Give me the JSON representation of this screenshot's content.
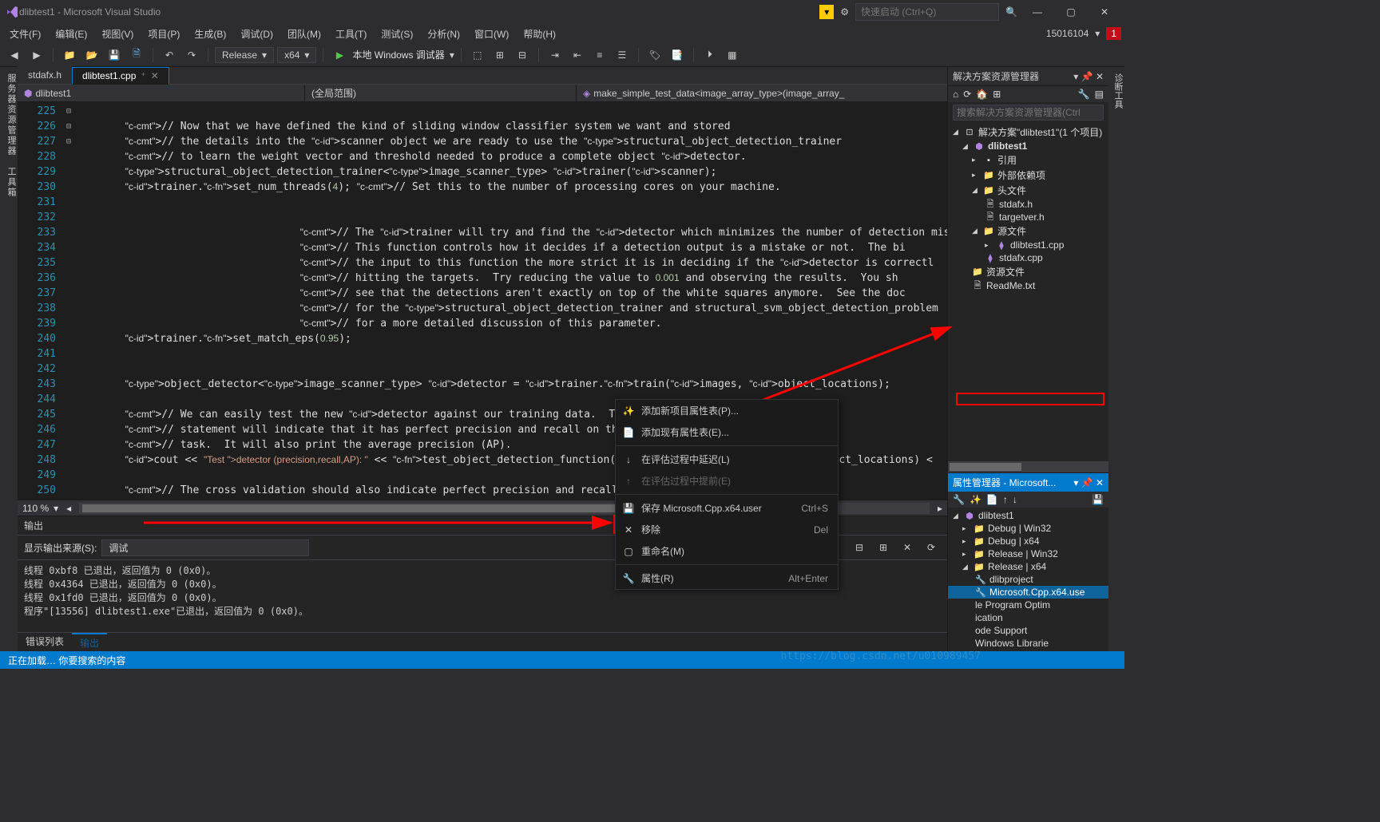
{
  "titlebar": {
    "title": "dlibtest1 - Microsoft Visual Studio",
    "quickstart": "快速启动 (Ctrl+Q)"
  },
  "menubar": {
    "items": [
      "文件(F)",
      "编辑(E)",
      "视图(V)",
      "项目(P)",
      "生成(B)",
      "调试(D)",
      "团队(M)",
      "工具(T)",
      "测试(S)",
      "分析(N)",
      "窗口(W)",
      "帮助(H)"
    ],
    "userid": "15016104",
    "notif": "1"
  },
  "toolbar": {
    "config": "Release",
    "platform": "x64",
    "debugger": "本地 Windows 调试器"
  },
  "tabs": {
    "inactive": "stdafx.h",
    "active": "dlibtest1.cpp"
  },
  "navbar": {
    "proj": "dlibtest1",
    "scope": "(全局范围)",
    "func": "make_simple_test_data<image_array_type>(image_array_"
  },
  "lines": {
    "start": 225,
    "end": 250
  },
  "code": [
    "",
    "        // Now that we have defined the kind of sliding window classifier system we want and stored",
    "        // the details into the scanner object we are ready to use the structural_object_detection_trainer",
    "        // to learn the weight vector and threshold needed to produce a complete object detector.",
    "        structural_object_detection_trainer<image_scanner_type> trainer(scanner);",
    "        trainer.set_num_threads(4); // Set this to the number of processing cores on your machine.",
    "",
    "",
    "                                    // The trainer will try and find the detector which minimizes the number of detection mista",
    "                                    // This function controls how it decides if a detection output is a mistake or not.  The bi",
    "                                    // the input to this function the more strict it is in deciding if the detector is correctl",
    "                                    // hitting the targets.  Try reducing the value to 0.001 and observing the results.  You sh",
    "                                    // see that the detections aren't exactly on top of the white squares anymore.  See the doc",
    "                                    // for the structural_object_detection_trainer and structural_svm_object_detection_problem ",
    "                                    // for a more detailed discussion of this parameter.",
    "        trainer.set_match_eps(0.95);",
    "",
    "",
    "        object_detector<image_scanner_type> detector = trainer.train(images, object_locations);",
    "",
    "        // We can easily test the new detector against our training data.  This print ",
    "        // statement will indicate that it has perfect precision and recall on this simple",
    "        // task.  It will also print the average precision (AP).",
    "        cout << \"Test detector (precision,recall,AP): \" << test_object_detection_function(detector, images, object_locations) <",
    "",
    "        // The cross validation should also indicate perfect precision and recall."
  ],
  "zoom": "110 %",
  "output": {
    "title": "输出",
    "src_label": "显示输出来源(S):",
    "src_value": "调试",
    "lines": [
      "线程 0xbf8 已退出，返回值为 0 (0x0)。",
      "线程 0x4364 已退出，返回值为 0 (0x0)。",
      "线程 0x1fd0 已退出，返回值为 0 (0x0)。",
      "程序\"[13556] dlibtest1.exe\"已退出，返回值为 0 (0x0)。"
    ],
    "footer": [
      "错误列表",
      "输出"
    ]
  },
  "solution": {
    "title": "解决方案资源管理器",
    "search_ph": "搜索解决方案资源管理器(Ctrl",
    "root": "解决方案\"dlibtest1\"(1 个项目)",
    "proj": "dlibtest1",
    "refs": "引用",
    "ext": "外部依赖项",
    "headers": "头文件",
    "h1": "stdafx.h",
    "h2": "targetver.h",
    "src": "源文件",
    "s1": "dlibtest1.cpp",
    "s2": "stdafx.cpp",
    "res": "资源文件",
    "readme": "ReadMe.txt"
  },
  "props": {
    "title": "属性管理器 - Microsoft...",
    "proj": "dlibtest1",
    "dw32": "Debug | Win32",
    "dx64": "Debug | x64",
    "rw32": "Release | Win32",
    "rx64": "Release | x64",
    "dlibproj": "dlibproject",
    "ms": "Microsoft.Cpp.x64.use",
    "p1": "le Program Optim",
    "p2": "ication",
    "p3": "ode Support",
    "p4": "Windows Librarie"
  },
  "ctx": {
    "i1": "添加新项目属性表(P)...",
    "i2": "添加现有属性表(E)...",
    "i3": "在评估过程中延迟(L)",
    "i4": "在评估过程中提前(E)",
    "i5": "保存 Microsoft.Cpp.x64.user",
    "k5": "Ctrl+S",
    "i6": "移除",
    "k6": "Del",
    "i7": "重命名(M)",
    "i8": "属性(R)",
    "k8": "Alt+Enter"
  },
  "status": "正在加载…  你要搜索的内容",
  "watermark": "https://blog.csdn.net/u010989457"
}
